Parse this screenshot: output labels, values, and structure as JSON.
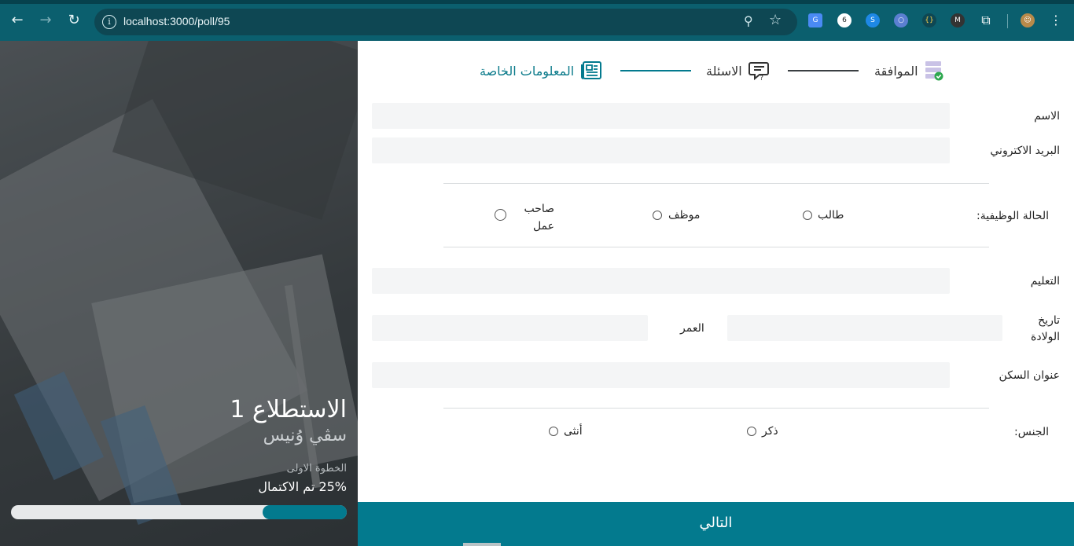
{
  "browser": {
    "url": "localhost:3000/poll/95"
  },
  "poll": {
    "title": "الاستطلاع 1",
    "subtitle": "سڨي وُنيس",
    "step_label": "الخطوة الاولى",
    "progress_text": "25% تم الاكتمال",
    "progress_percent": 25
  },
  "steps": [
    {
      "label": "الموافقة",
      "icon": "server-check-icon",
      "state": "done"
    },
    {
      "label": "الاسئلة",
      "icon": "chat-question-icon",
      "state": "done"
    },
    {
      "label": "المعلومات الخاصة",
      "icon": "newspaper-icon",
      "state": "active"
    }
  ],
  "form": {
    "name_label": "الاسم",
    "email_label": "البريد الاكتروني",
    "job_status_label": "الحالة الوظيفية:",
    "job_options": [
      "طالب",
      "موظف",
      "صاحب عمل"
    ],
    "education_label": "التعليم",
    "birth_date_label": "تاريخ الولادة",
    "age_label": "العمر",
    "address_label": "عنوان السكن",
    "gender_label": "الجنس:",
    "gender_options": [
      "ذكر",
      "أنثى"
    ]
  },
  "next_button": "التالي",
  "colors": {
    "accent": "#037a8e",
    "chrome": "#0b5f6e",
    "input_bg": "#f4f5f6"
  }
}
